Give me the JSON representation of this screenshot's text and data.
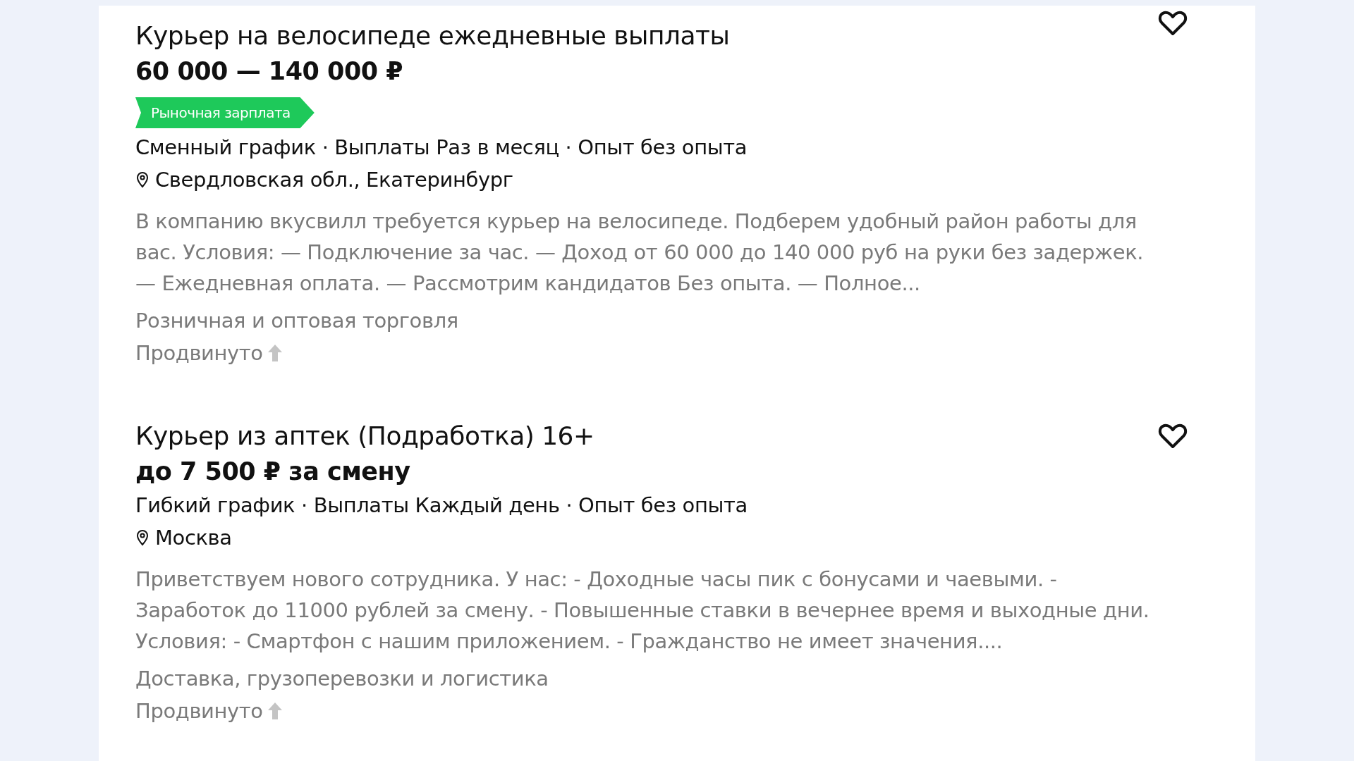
{
  "listings": [
    {
      "title": "Курьер на велосипеде ежедневные выплаты",
      "salary": "60 000 — 140 000 ₽",
      "badge": "Рыночная зарплата",
      "meta": "Сменный график · Выплаты Раз в месяц · Опыт без опыта",
      "location": "Свердловская обл., Екатеринбург",
      "description": "В компанию вкусвилл требуется курьер на велосипеде. Подберем удобный район работы для вас. Условия: — Подключение за час. — Доход от 60 000 до 140 000 руб на руки без задержек. — Ежедневная оплата. — Рассмотрим кандидатов Без опыта. — Полное...",
      "category": "Розничная и оптовая торговля",
      "promoted": "Продвинуто",
      "favorite": false
    },
    {
      "title": "Курьер из аптек (Подработка) 16+",
      "salary": "до 7 500 ₽ за смену",
      "meta": "Гибкий график · Выплаты Каждый день · Опыт без опыта",
      "location": "Москва",
      "description": "Приветствуем нового сотрудника. У нас: - Доходные часы пик с бонусами и чаевыми. - Заработок до 11000 рублей за смену. - Повышенные ставки в вечернее время и выходные дни. Условия: - Смартфон с нашим приложением. - Гражданство не имеет значения....",
      "category": "Доставка, грузоперевозки и логистика",
      "promoted": "Продвинуто",
      "favorite": false
    }
  ]
}
